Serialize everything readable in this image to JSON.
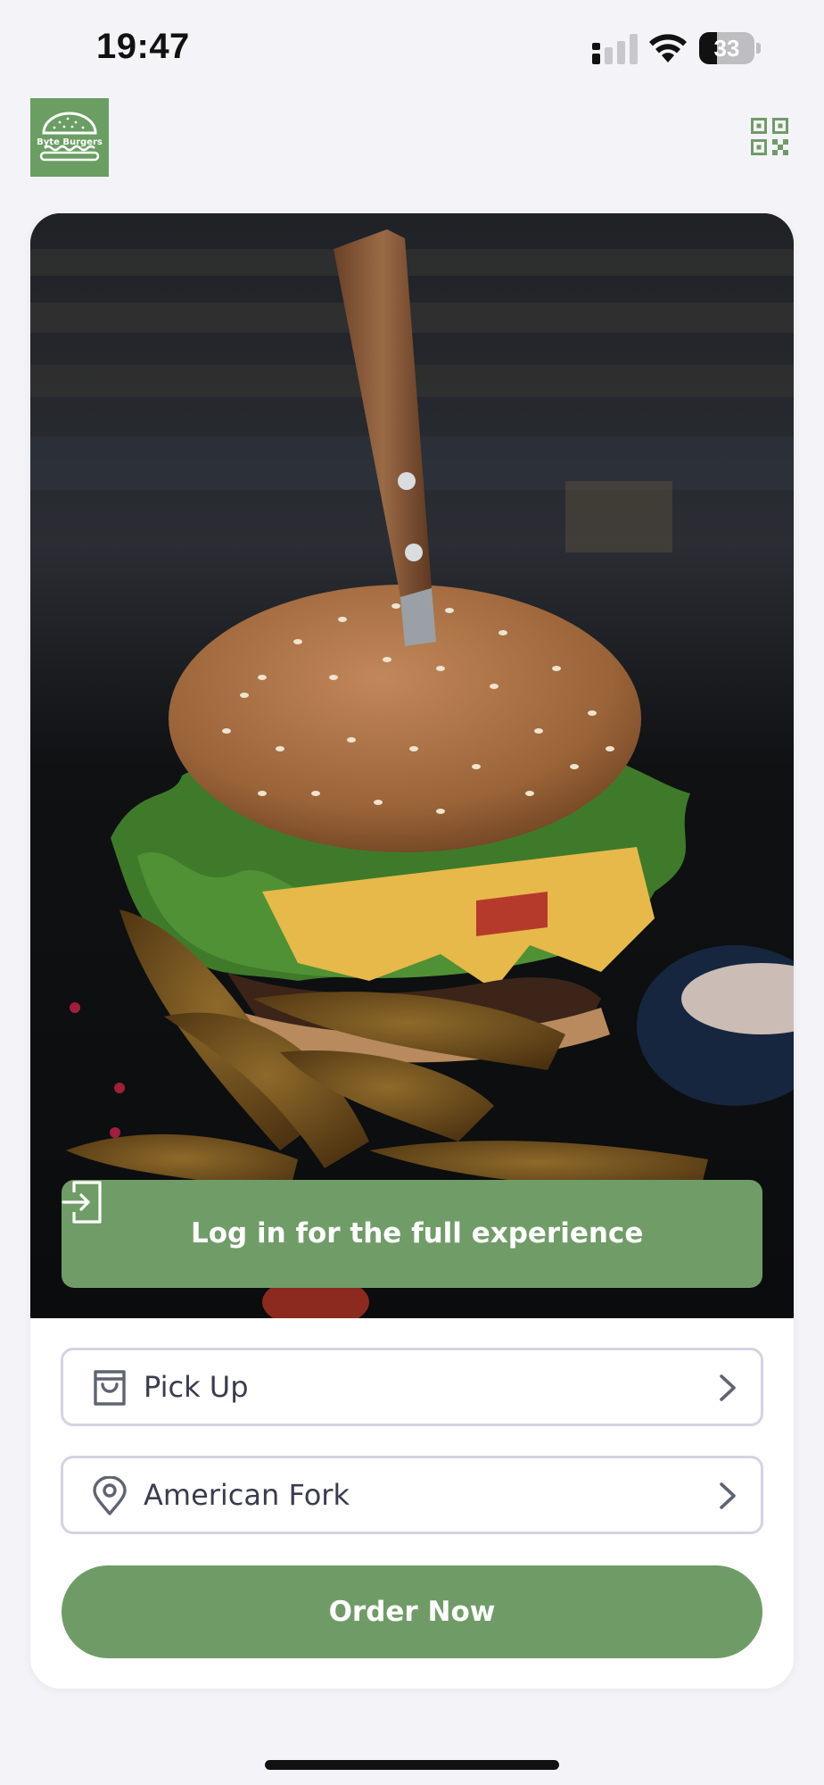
{
  "status_bar": {
    "time": "19:47",
    "battery_level": "33",
    "battery_percent": 33,
    "icons": [
      "cellular-signal-icon",
      "wifi-icon",
      "battery-icon"
    ]
  },
  "header": {
    "logo_text": "Byte Burgers",
    "qr_icon": "qr-code-icon"
  },
  "hero": {
    "login_banner": {
      "label": "Log in for the full experience",
      "icon": "login-icon"
    }
  },
  "options": {
    "order_type": {
      "label": "Pick Up",
      "icon": "shopping-bag-icon"
    },
    "location": {
      "label": "American Fork",
      "icon": "location-pin-icon"
    }
  },
  "order_button": {
    "label": "Order Now"
  },
  "colors": {
    "brand_green": "#709c67",
    "background": "#f4f4f8",
    "row_border": "#d4d3e3",
    "text": "#3b3b50"
  }
}
